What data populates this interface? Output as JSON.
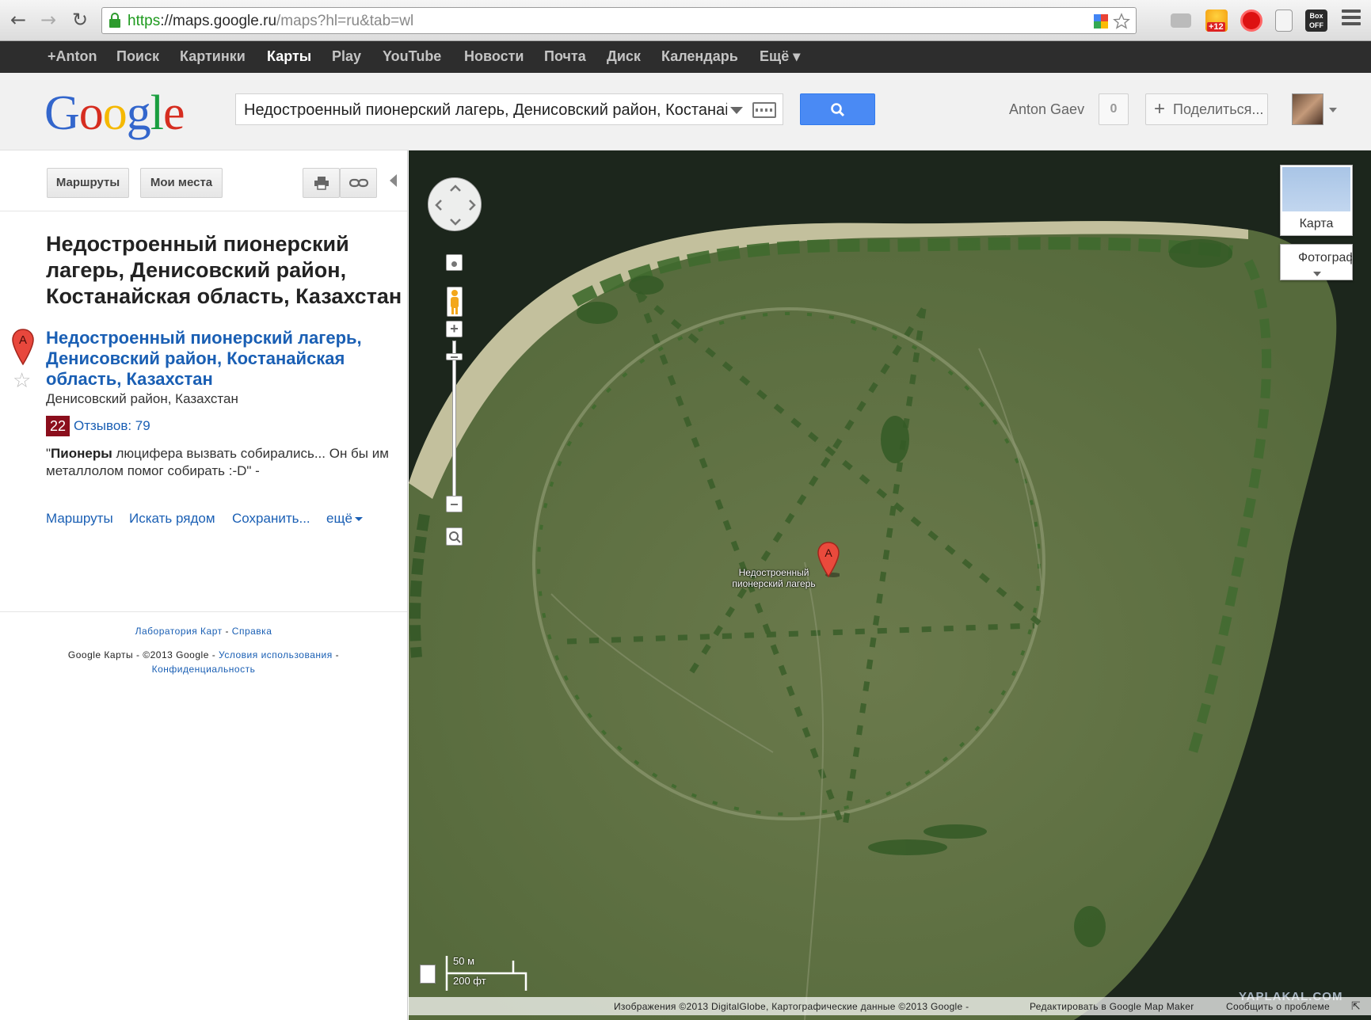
{
  "browser": {
    "back_icon": "back-arrow-icon",
    "forward_icon": "forward-arrow-icon",
    "reload_icon": "reload-icon",
    "url_scheme": "https",
    "url_host": "://maps.google.ru",
    "url_path": "/maps?hl=ru&tab=wl",
    "ext_badge": "+12",
    "boxoff_label": "Box\nOFF"
  },
  "gbar": {
    "items": [
      {
        "label": "+Anton"
      },
      {
        "label": "Поиск"
      },
      {
        "label": "Картинки"
      },
      {
        "label": "Карты"
      },
      {
        "label": "Play"
      },
      {
        "label": "YouTube"
      },
      {
        "label": "Новости"
      },
      {
        "label": "Почта"
      },
      {
        "label": "Диск"
      },
      {
        "label": "Календарь"
      },
      {
        "label": "Ещё ▾"
      }
    ],
    "active_index": 3
  },
  "header": {
    "logo_letters": [
      "G",
      "o",
      "o",
      "g",
      "l",
      "e"
    ],
    "logo_colors": [
      "#3366cc",
      "#d62d20",
      "#f5b800",
      "#3366cc",
      "#1a9e3f",
      "#d62d20"
    ],
    "search_value": "Недостроенный пионерский лагерь, Денисовский район, Костанайская область, Казахстан",
    "user_name": "Anton Gaev",
    "notifications": "0",
    "share_label": "Поделиться..."
  },
  "panel": {
    "directions_button": "Маршруты",
    "my_places_button": "Мои места",
    "title": "Недостроенный пионерский лагерь, Денисовский район, Костанайская область, Казахстан",
    "result": {
      "marker": "A",
      "link": "Недостроенный пионерский лагерь, Денисовский район, Костанайская область, Казахстан",
      "address": "Денисовский район, Казахстан",
      "rating": "22",
      "reviews": "Отзывов: 79",
      "snippet_bold": "Пионеры",
      "snippet_open_quote": "\"",
      "snippet_rest": " люцифера вызвать собирались... Он бы им металлолом помог собирать :-D\" -"
    },
    "actions": [
      "Маршруты",
      "Искать рядом",
      "Сохранить...",
      "ещё"
    ],
    "footer": {
      "labs": "Лаборатория Карт",
      "sep": " - ",
      "help": "Справка",
      "copyright": "Google Карты - ©2013 Google - ",
      "terms": "Условия использования",
      "sep2": " - ",
      "privacy": "Конфиденциальность"
    }
  },
  "map": {
    "maptype_map": "Карта",
    "maptype_photo": "Фотографии",
    "marker": "A",
    "marker_label": "Недостроенный пионерский лагерь",
    "scale_m": "50 м",
    "scale_ft": "200 фт",
    "attribution": "Изображения ©2013 DigitalGlobe, Картографические данные ©2013 Google -",
    "edit_link": "Редактировать в Google Map Maker",
    "report_link": "Сообщить о проблеме",
    "watermark": "YAPLAKAL.COM",
    "colors": {
      "water": "#1d2a1f",
      "grass": "#66744a",
      "sand": "#d9d3b5",
      "trees": "#3f6a2e"
    }
  }
}
